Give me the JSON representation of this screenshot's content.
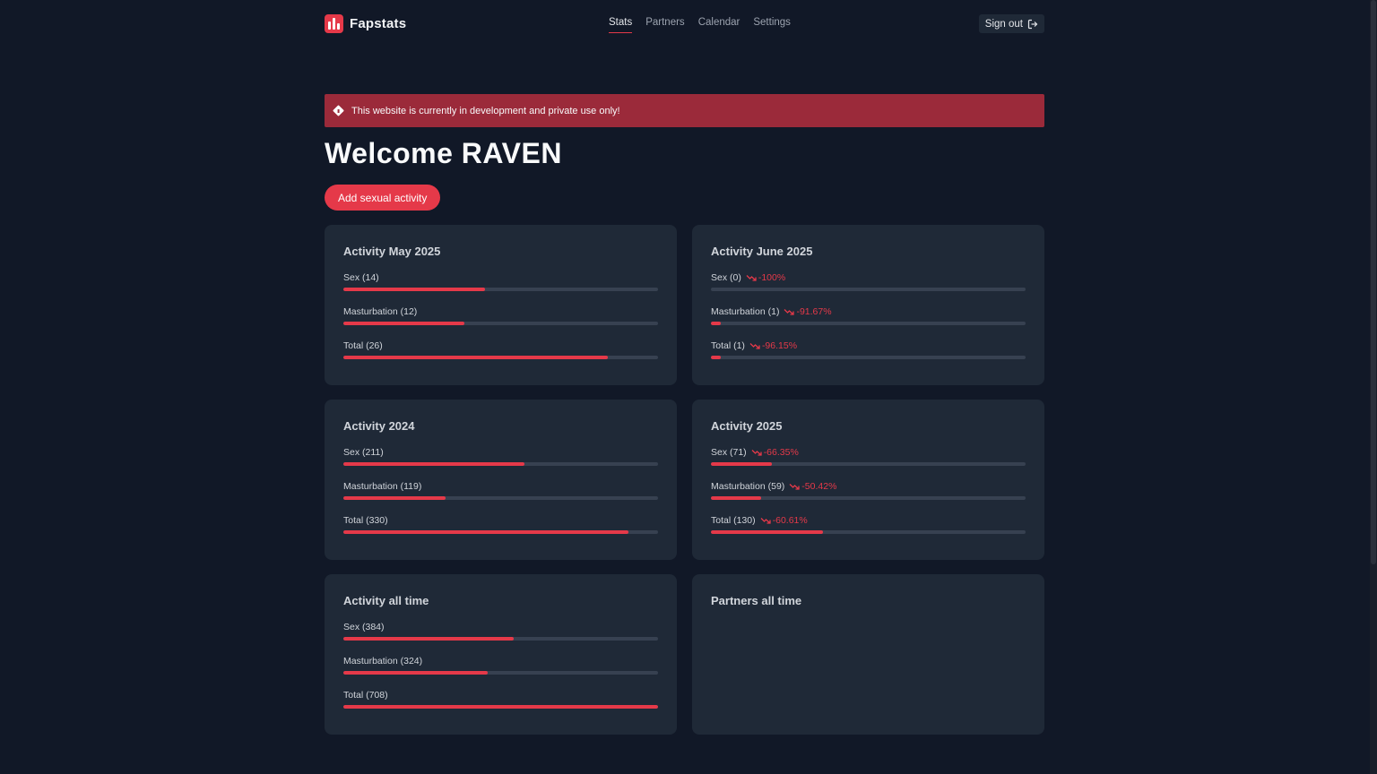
{
  "brand": {
    "name": "Fapstats"
  },
  "nav": [
    {
      "label": "Stats",
      "active": true
    },
    {
      "label": "Partners",
      "active": false
    },
    {
      "label": "Calendar",
      "active": false
    },
    {
      "label": "Settings",
      "active": false
    }
  ],
  "header": {
    "signout_label": "Sign out"
  },
  "alert": {
    "text": "This website is currently in development and private use only!"
  },
  "welcome": {
    "title": "Welcome RAVEN"
  },
  "actions": {
    "add_label": "Add sexual activity"
  },
  "cards": [
    {
      "title": "Activity May 2025",
      "rows": [
        {
          "label": "Sex (14)",
          "trend": "",
          "fill": 0.45
        },
        {
          "label": "Masturbation (12)",
          "trend": "",
          "fill": 0.385
        },
        {
          "label": "Total (26)",
          "trend": "",
          "fill": 0.84
        }
      ]
    },
    {
      "title": "Activity June 2025",
      "rows": [
        {
          "label": "Sex (0)",
          "trend": "-100%",
          "fill": 0
        },
        {
          "label": "Masturbation (1)",
          "trend": "-91.67%",
          "fill": 0.03
        },
        {
          "label": "Total (1)",
          "trend": "-96.15%",
          "fill": 0.03
        }
      ]
    },
    {
      "title": "Activity 2024",
      "rows": [
        {
          "label": "Sex (211)",
          "trend": "",
          "fill": 0.575
        },
        {
          "label": "Masturbation (119)",
          "trend": "",
          "fill": 0.325
        },
        {
          "label": "Total (330)",
          "trend": "",
          "fill": 0.905
        }
      ]
    },
    {
      "title": "Activity 2025",
      "rows": [
        {
          "label": "Sex (71)",
          "trend": "-66.35%",
          "fill": 0.195
        },
        {
          "label": "Masturbation (59)",
          "trend": "-50.42%",
          "fill": 0.16
        },
        {
          "label": "Total (130)",
          "trend": "-60.61%",
          "fill": 0.355
        }
      ]
    },
    {
      "title": "Activity all time",
      "rows": [
        {
          "label": "Sex (384)",
          "trend": "",
          "fill": 0.54
        },
        {
          "label": "Masturbation (324)",
          "trend": "",
          "fill": 0.46
        },
        {
          "label": "Total (708)",
          "trend": "",
          "fill": 1.0
        }
      ]
    },
    {
      "title": "Partners all time",
      "rows": []
    }
  ]
}
